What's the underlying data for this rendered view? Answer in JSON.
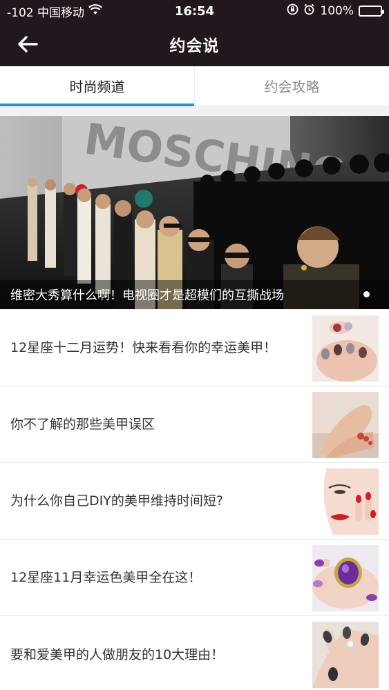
{
  "status_bar": {
    "carrier": "-102 中国移动",
    "time": "16:54",
    "battery": "100%",
    "battery_level": 1.0
  },
  "nav": {
    "title": "约会说",
    "back_icon": "arrow-left-icon"
  },
  "tabs": [
    {
      "label": "时尚频道",
      "active": true
    },
    {
      "label": "约会攻略",
      "active": false
    }
  ],
  "banner": {
    "caption": "维密大秀算什么啊！电视圈才是超模们的互撕战场",
    "backdrop_text": "MOSCHINO"
  },
  "articles": [
    {
      "title": "12星座十二月运势！快来看看你的幸运美甲！",
      "thumb": "nail-art-thumbnail"
    },
    {
      "title": "你不了解的那些美甲误区",
      "thumb": "feet-pedicure-thumbnail"
    },
    {
      "title": "为什么你自己DIY的美甲维持时间短?",
      "thumb": "red-lips-red-nails-thumbnail"
    },
    {
      "title": "12星座11月幸运色美甲全在这！",
      "thumb": "purple-ring-nails-thumbnail"
    },
    {
      "title": "要和爱美甲的人做朋友的10大理由！",
      "thumb": "dark-nails-ring-thumbnail"
    }
  ],
  "colors": {
    "header_bg": "#21171f",
    "tab_indicator": "#2f8fd8",
    "page_bg": "#f2f2f2"
  }
}
